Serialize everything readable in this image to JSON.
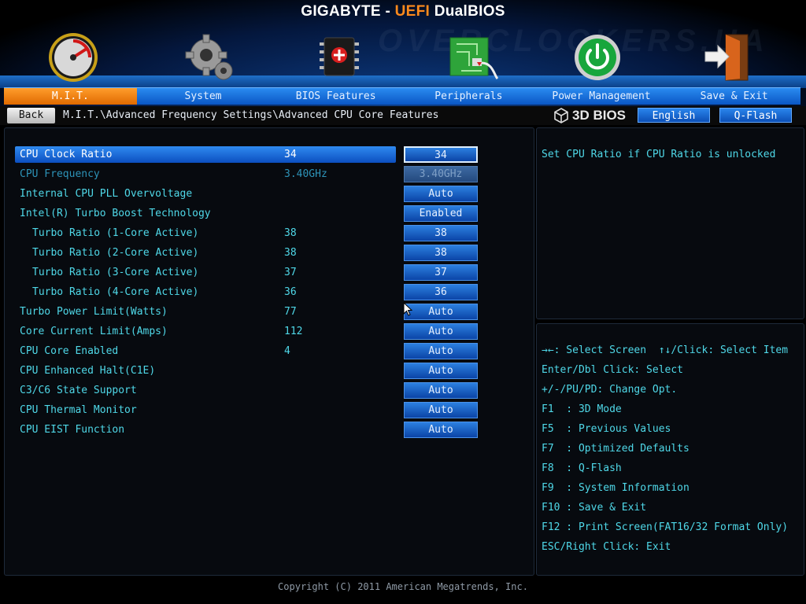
{
  "brand": {
    "part1": "GIGABYTE - ",
    "accent": "UEFI",
    "part2": " DualBIOS"
  },
  "watermark": "OVERCLOCKERS.UA",
  "tabs": [
    {
      "label": "M.I.T.",
      "active": true
    },
    {
      "label": "System"
    },
    {
      "label": "BIOS Features"
    },
    {
      "label": "Peripherals"
    },
    {
      "label": "Power Management"
    },
    {
      "label": "Save & Exit"
    }
  ],
  "top_icons": [
    "speedometer-icon",
    "gear-icon",
    "chip-icon",
    "circuit-board-icon",
    "power-icon",
    "exit-door-icon"
  ],
  "breadcrumb_bar": {
    "back_label": "Back",
    "path": "M.I.T.\\Advanced Frequency Settings\\Advanced CPU Core Features",
    "logo": "3D BIOS",
    "language_label": "English",
    "qflash_label": "Q-Flash"
  },
  "settings": [
    {
      "label": "CPU Clock Ratio",
      "value": "34",
      "option": "34",
      "selected": true
    },
    {
      "label": "CPU Frequency",
      "value": "3.40GHz",
      "option": "3.40GHz",
      "disabled": true
    },
    {
      "label": "Internal CPU PLL Overvoltage",
      "value": "",
      "option": "Auto"
    },
    {
      "label": "Intel(R) Turbo Boost Technology",
      "value": "",
      "option": "Enabled"
    },
    {
      "label": "Turbo Ratio (1-Core Active)",
      "value": "38",
      "option": "38",
      "indent": true
    },
    {
      "label": "Turbo Ratio (2-Core Active)",
      "value": "38",
      "option": "38",
      "indent": true
    },
    {
      "label": "Turbo Ratio (3-Core Active)",
      "value": "37",
      "option": "37",
      "indent": true
    },
    {
      "label": "Turbo Ratio (4-Core Active)",
      "value": "36",
      "option": "36",
      "indent": true
    },
    {
      "label": "Turbo Power Limit(Watts)",
      "value": "77",
      "option": "Auto"
    },
    {
      "label": "Core Current Limit(Amps)",
      "value": "112",
      "option": "Auto"
    },
    {
      "label": "CPU Core Enabled",
      "value": "4",
      "option": "Auto"
    },
    {
      "label": "CPU Enhanced Halt(C1E)",
      "value": "",
      "option": "Auto"
    },
    {
      "label": "C3/C6 State Support",
      "value": "",
      "option": "Auto"
    },
    {
      "label": "CPU Thermal Monitor",
      "value": "",
      "option": "Auto"
    },
    {
      "label": "CPU EIST Function",
      "value": "",
      "option": "Auto"
    }
  ],
  "help": {
    "text": "Set CPU Ratio if CPU Ratio is unlocked"
  },
  "keys": [
    "→←: Select Screen  ↑↓/Click: Select Item",
    "Enter/Dbl Click: Select",
    "+/-/PU/PD: Change Opt.",
    "F1  : 3D Mode",
    "F5  : Previous Values",
    "F7  : Optimized Defaults",
    "F8  : Q-Flash",
    "F9  : System Information",
    "F10 : Save & Exit",
    "F12 : Print Screen(FAT16/32 Format Only)",
    "ESC/Right Click: Exit"
  ],
  "footer": {
    "copyright": "Copyright (C) 2011 American Megatrends, Inc."
  },
  "colors": {
    "accent": "#ff8a1c",
    "text": "#4fd8e8",
    "tab_active": "#f07a0a",
    "tab_bar": "#1a6fe0"
  }
}
